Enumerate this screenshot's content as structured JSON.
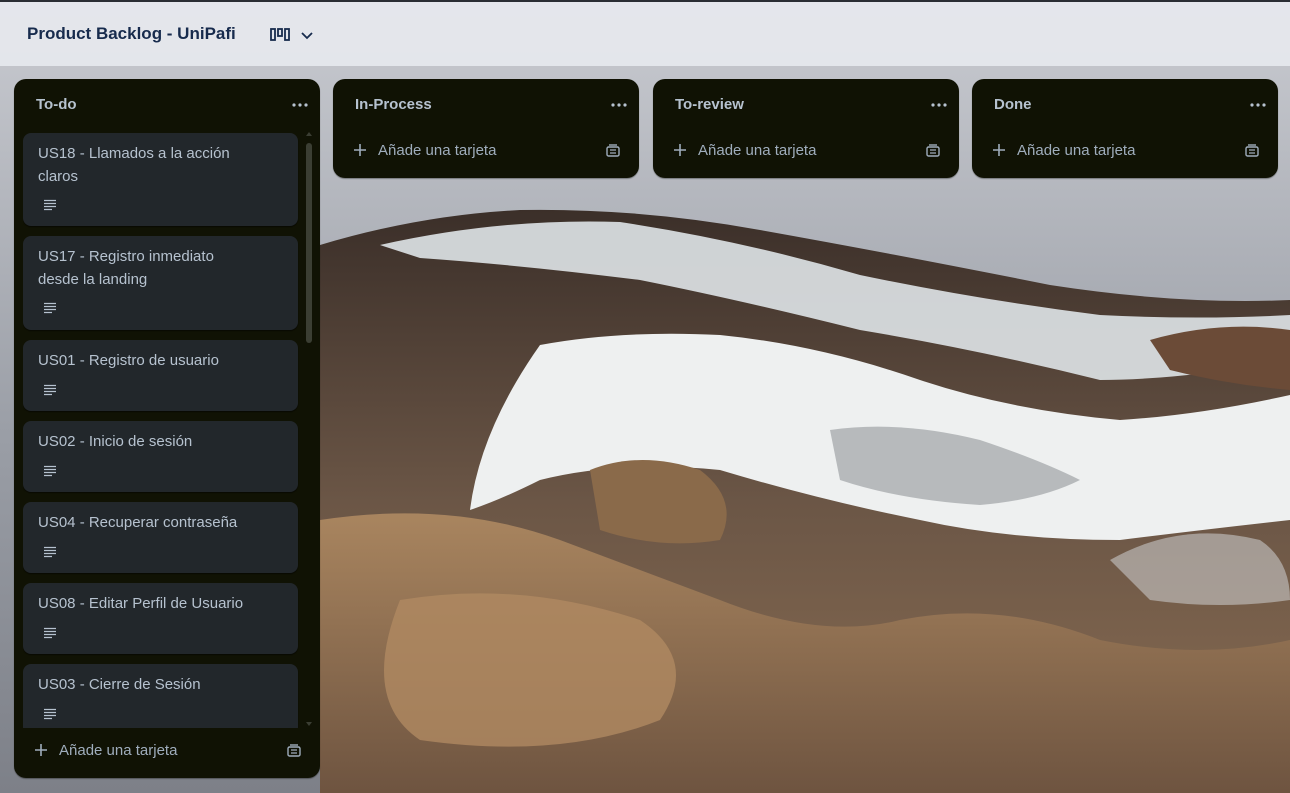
{
  "board": {
    "title": "Product Backlog - UniPafi",
    "view_icon": "board-view-icon",
    "switch_icon": "chevron-down-icon"
  },
  "lists": [
    {
      "title": "To-do",
      "menu_icon": "ellipsis-icon",
      "cards": [
        {
          "title": "US18 - Llamados a la acción claros",
          "icon": "description-icon"
        },
        {
          "title": "US17 - Registro inmediato desde la landing",
          "icon": "description-icon"
        },
        {
          "title": "US01 - Registro de usuario",
          "icon": "description-icon"
        },
        {
          "title": "US02 - Inicio de sesión",
          "icon": "description-icon"
        },
        {
          "title": "US04 - Recuperar contraseña",
          "icon": "description-icon"
        },
        {
          "title": "US08 - Editar Perfil de Usuario",
          "icon": "description-icon"
        },
        {
          "title": "US03 - Cierre de Sesión",
          "icon": "description-icon"
        }
      ],
      "add_label": "Añade una tarjeta"
    },
    {
      "title": "In-Process",
      "menu_icon": "ellipsis-icon",
      "cards": [],
      "add_label": "Añade una tarjeta"
    },
    {
      "title": "To-review",
      "menu_icon": "ellipsis-icon",
      "cards": [],
      "add_label": "Añade una tarjeta"
    },
    {
      "title": "Done",
      "menu_icon": "ellipsis-icon",
      "cards": [],
      "add_label": "Añade una tarjeta"
    }
  ],
  "colors": {
    "list_bg": "#101204",
    "card_bg": "#22272b",
    "text": "#b6c2cf",
    "header_text": "#172b4d"
  }
}
